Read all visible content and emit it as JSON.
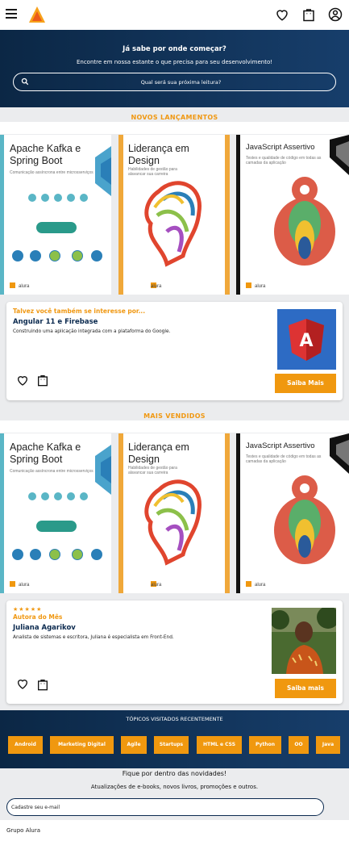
{
  "header": {
    "menu_icon": "hamburger-icon",
    "logo_icon": "alura-logo",
    "icons": [
      "heart-icon",
      "shopping-bag-icon",
      "user-icon"
    ]
  },
  "hero": {
    "title": "Já sabe por onde começar?",
    "subtitle": "Encontre em nossa estante o que precisa para seu desenvolvimento!",
    "search_placeholder": "Qual será sua próxima leitura?"
  },
  "new_releases": {
    "title": "NOVOS LANÇAMENTOS",
    "books": [
      {
        "title": "Apache Kafka e Spring Boot",
        "subtitle": "Comunicação assíncrona entre microsserviços",
        "brand": "alura"
      },
      {
        "title": "Liderança em Design",
        "subtitle": "Habilidades de gestão para alavancar sua carreira",
        "brand": "alura"
      },
      {
        "title": "JavaScript Assertivo",
        "subtitle": "Testes e qualidade de código em todas as camadas da aplicação",
        "brand": "alura"
      }
    ],
    "pager_pages": 4,
    "pager_active": 0
  },
  "suggestion_card": {
    "tag": "Talvez você também se interesse por...",
    "name": "Angular 11 e Firebase",
    "description": "Construindo uma aplicação integrada com a plataforma do Google.",
    "button": "Saiba Mais"
  },
  "best_sellers": {
    "title": "MAIS VENDIDOS",
    "books": [
      {
        "title": "Apache Kafka e Spring Boot",
        "subtitle": "Comunicação assíncrona entre microsserviços",
        "brand": "alura"
      },
      {
        "title": "Liderança em Design",
        "subtitle": "Habilidades de gestão para alavancar sua carreira",
        "brand": "alura"
      },
      {
        "title": "JavaScript Assertivo",
        "subtitle": "Testes e qualidade de código em todas as camadas da aplicação",
        "brand": "alura"
      }
    ],
    "pager_pages": 4,
    "pager_active": 0
  },
  "author_card": {
    "stars": "★★★★★",
    "tag": "Autora do Mês",
    "name": "Juliana Agarikov",
    "description": "Analista de sistemas e escritora, Juliana é especialista em Front-End.",
    "button": "Saiba mais"
  },
  "topics": {
    "title": "TÓPICOS VISITADOS RECENTEMENTE",
    "items": [
      "Android",
      "Marketing Digital",
      "Agile",
      "Startups",
      "HTML e CSS",
      "Python",
      "OO",
      "Java"
    ]
  },
  "newsletter": {
    "title": "Fique por dentro das novidades!",
    "subtitle": "Atualizações de e-books, novos livros, promoções e outros.",
    "placeholder": "Cadastre seu e-mail"
  },
  "footer": {
    "text": "Grupo Alura"
  },
  "colors": {
    "accent": "#f0980f",
    "navy": "#0b2745",
    "link": "#0b2a4f"
  }
}
